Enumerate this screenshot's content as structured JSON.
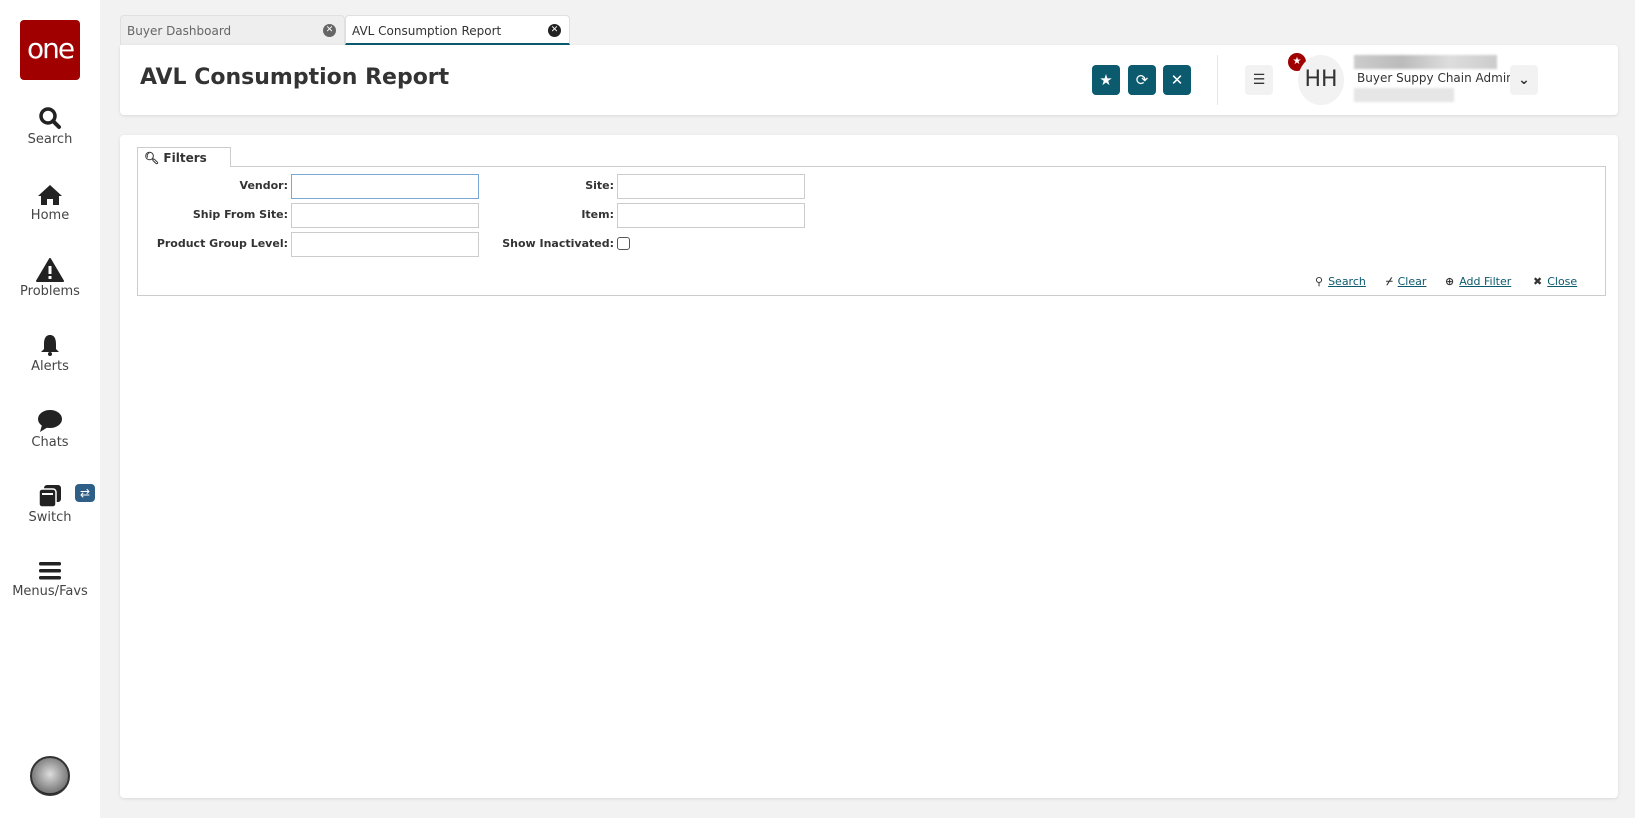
{
  "sidebar": {
    "logo": "one",
    "items": [
      {
        "label": "Search",
        "icon": "search-icon"
      },
      {
        "label": "Home",
        "icon": "home-icon"
      },
      {
        "label": "Problems",
        "icon": "warning-icon"
      },
      {
        "label": "Alerts",
        "icon": "bell-icon"
      },
      {
        "label": "Chats",
        "icon": "chat-icon"
      },
      {
        "label": "Switch",
        "icon": "switch-icon"
      },
      {
        "label": "Menus/Favs",
        "icon": "menu-icon"
      }
    ]
  },
  "tabs": [
    {
      "label": "Buyer Dashboard",
      "active": false
    },
    {
      "label": "AVL Consumption Report",
      "active": true
    }
  ],
  "header": {
    "title": "AVL Consumption Report",
    "user_initials": "HH",
    "user_role": "Buyer Suppy Chain Admin"
  },
  "filters": {
    "tab_label": "Filters",
    "fields": {
      "vendor": "Vendor:",
      "ship_from_site": "Ship From Site:",
      "product_group_level": "Product Group Level:",
      "site": "Site:",
      "item": "Item:",
      "show_inactivated": "Show Inactivated:"
    },
    "actions": {
      "search": "Search",
      "clear": "Clear",
      "add_filter": "Add Filter",
      "close": "Close"
    }
  },
  "colors": {
    "brand": "#a00000",
    "accent": "#0b5a6e"
  }
}
